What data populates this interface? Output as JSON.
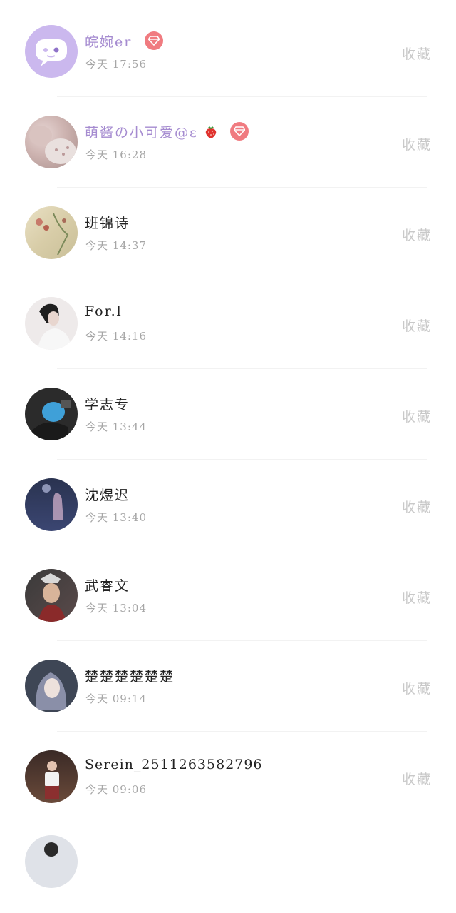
{
  "colors": {
    "vip_name": "#a58bd0",
    "badge": "#f07b80",
    "time": "#a6a6a6",
    "fav": "#c9c9c9"
  },
  "items": [
    {
      "name": "皖婉er",
      "time": "今天 17:56",
      "fav": "收藏",
      "vip": true,
      "badge_icon": "diamond-icon"
    },
    {
      "name": "萌酱の小可爱@ε",
      "time": "今天 16:28",
      "fav": "收藏",
      "vip": true,
      "badge_icon": "diamond-icon",
      "emoji": "strawberry-icon"
    },
    {
      "name": "班锦诗",
      "time": "今天 14:37",
      "fav": "收藏"
    },
    {
      "name": "For.l",
      "time": "今天 14:16",
      "fav": "收藏"
    },
    {
      "name": "学志专",
      "time": "今天 13:44",
      "fav": "收藏"
    },
    {
      "name": "沈煜迟",
      "time": "今天 13:40",
      "fav": "收藏"
    },
    {
      "name": "武睿文",
      "time": "今天 13:04",
      "fav": "收藏"
    },
    {
      "name": "楚楚楚楚楚楚",
      "time": "今天 09:14",
      "fav": "收藏"
    },
    {
      "name": "Serein_2511263582796",
      "time": "今天 09:06",
      "fav": "收藏"
    }
  ]
}
